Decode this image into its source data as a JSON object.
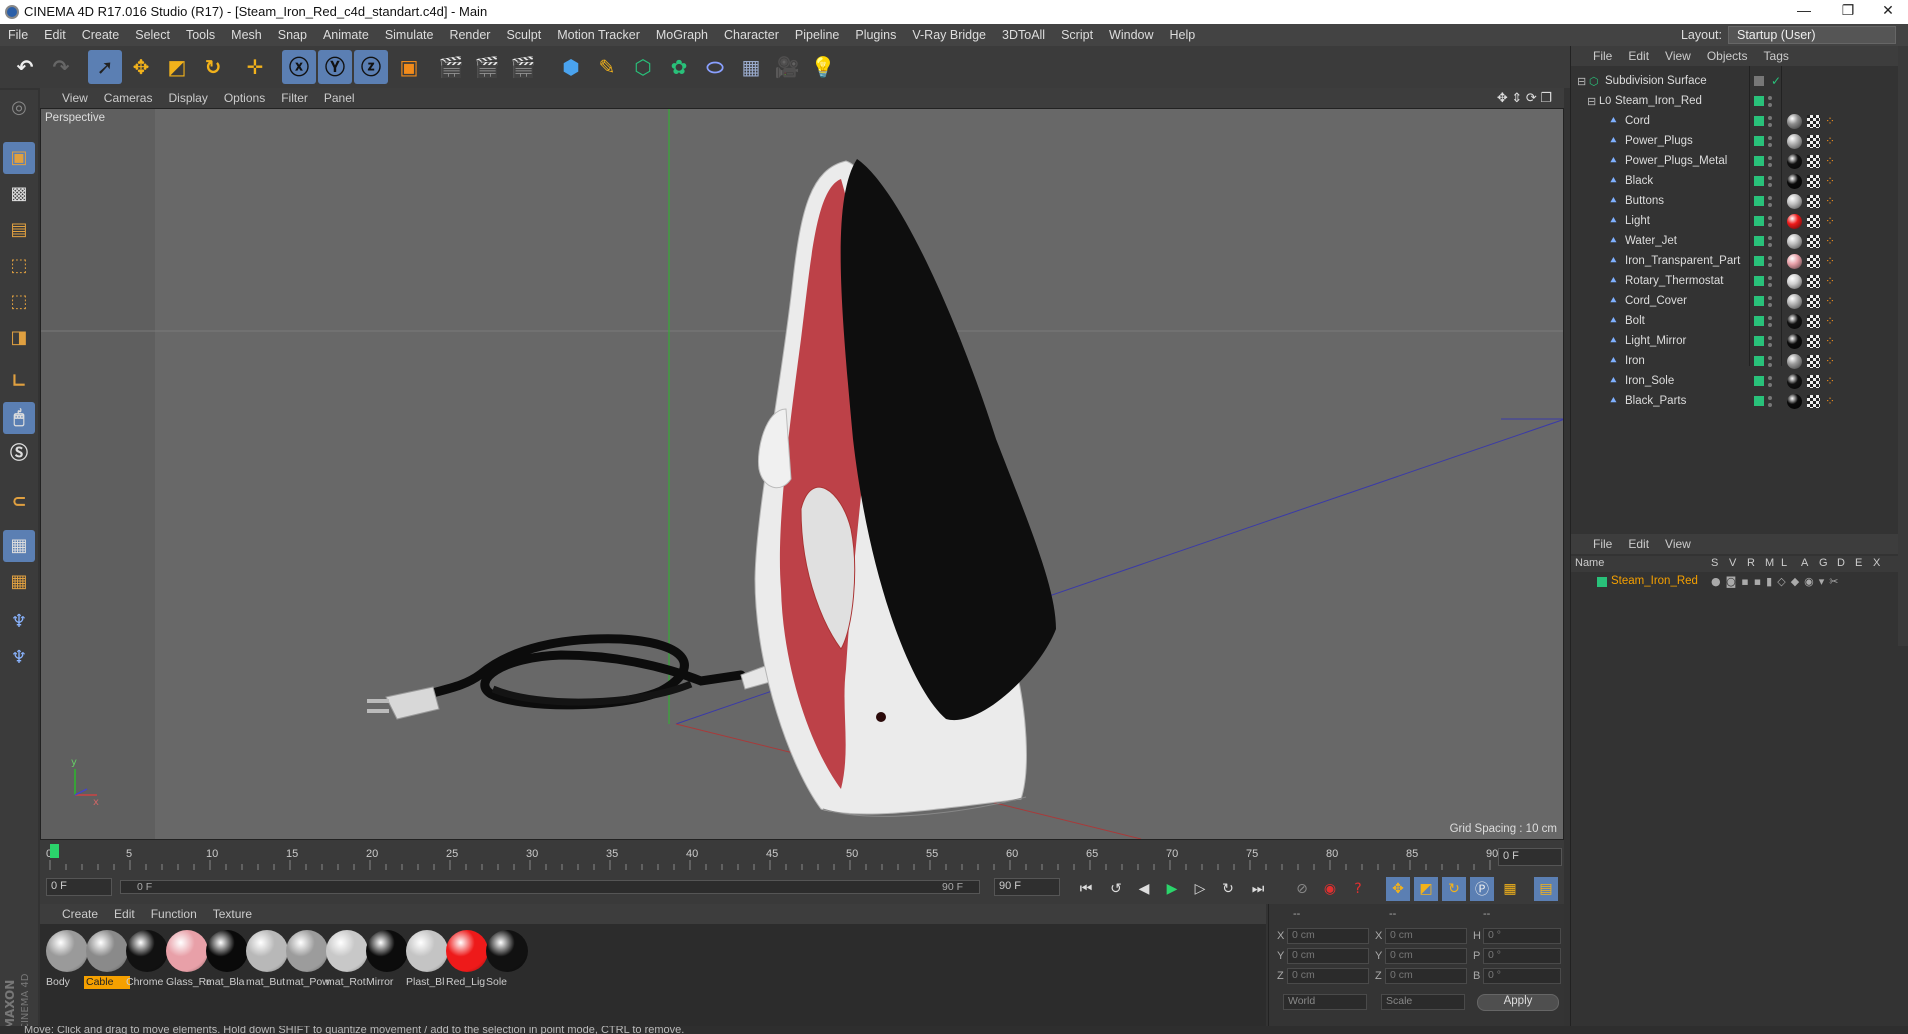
{
  "window": {
    "title": "CINEMA 4D R17.016 Studio (R17) - [Steam_Iron_Red_c4d_standart.c4d] - Main",
    "controls": [
      "—",
      "❐",
      "✕"
    ]
  },
  "menubar": [
    "File",
    "Edit",
    "Create",
    "Select",
    "Tools",
    "Mesh",
    "Snap",
    "Animate",
    "Simulate",
    "Render",
    "Sculpt",
    "Motion Tracker",
    "MoGraph",
    "Character",
    "Pipeline",
    "Plugins",
    "V-Ray Bridge",
    "3DToAll",
    "Script",
    "Window",
    "Help"
  ],
  "layout": {
    "label": "Layout:",
    "value": "Startup (User)"
  },
  "viewport": {
    "menu": [
      "View",
      "Cameras",
      "Display",
      "Options",
      "Filter",
      "Panel"
    ],
    "camera_label": "Perspective",
    "grid_spacing": "Grid Spacing : 10 cm",
    "axis_y": "y",
    "axis_x": "x"
  },
  "timeline": {
    "ticks": [
      "0",
      "5",
      "10",
      "15",
      "20",
      "25",
      "30",
      "35",
      "40",
      "45",
      "50",
      "55",
      "60",
      "65",
      "70",
      "75",
      "80",
      "85",
      "90"
    ],
    "current_frame_field": "0 F",
    "start_field": "0 F",
    "range_start": "0 F",
    "range_end": "90 F",
    "end_field": "90 F"
  },
  "materials": {
    "menu": [
      "Create",
      "Edit",
      "Function",
      "Texture"
    ],
    "items": [
      {
        "label": "Body",
        "color": "#9a9a9a"
      },
      {
        "label": "Cable",
        "color": "#8a8a8a",
        "selected": true
      },
      {
        "label": "Chrome",
        "color": "#111111"
      },
      {
        "label": "Glass_Re",
        "color": "#e8a0a8"
      },
      {
        "label": "mat_Bla",
        "color": "#0a0a0a"
      },
      {
        "label": "mat_But",
        "color": "#b8b8b8"
      },
      {
        "label": "mat_Pow",
        "color": "#9c9c9c"
      },
      {
        "label": "mat_Rot",
        "color": "#c8c8c8"
      },
      {
        "label": "Mirror",
        "color": "#0c0c0c"
      },
      {
        "label": "Plast_Bl",
        "color": "#c4c4c4"
      },
      {
        "label": "Red_Lig",
        "color": "#ee1a1a"
      },
      {
        "label": "Sole",
        "color": "#111111"
      }
    ]
  },
  "coords": {
    "headers": [
      "--",
      "--",
      "--"
    ],
    "rows": [
      {
        "a": "X",
        "av": "0 cm",
        "b": "X",
        "bv": "0 cm",
        "c": "H",
        "cv": "0 °"
      },
      {
        "a": "Y",
        "av": "0 cm",
        "b": "Y",
        "bv": "0 cm",
        "c": "P",
        "cv": "0 °"
      },
      {
        "a": "Z",
        "av": "0 cm",
        "b": "Z",
        "bv": "0 cm",
        "c": "B",
        "cv": "0 °"
      }
    ],
    "space": "World",
    "mode": "Scale",
    "apply": "Apply"
  },
  "object_manager": {
    "menu": [
      "File",
      "Edit",
      "View",
      "Objects",
      "Tags"
    ],
    "root": "Subdivision Surface",
    "group": "Steam_Iron_Red",
    "objects": [
      {
        "name": "Cord",
        "tag": "#8c8c8c"
      },
      {
        "name": "Power_Plugs",
        "tag": "#b0b0b0"
      },
      {
        "name": "Power_Plugs_Metal",
        "tag": "#111111"
      },
      {
        "name": "Black",
        "tag": "#0a0a0a"
      },
      {
        "name": "Buttons",
        "tag": "#c0c0c0"
      },
      {
        "name": "Light",
        "tag": "#ee1a1a"
      },
      {
        "name": "Water_Jet",
        "tag": "#bdbdbd"
      },
      {
        "name": "Iron_Transparent_Part",
        "tag": "#e8a0a8"
      },
      {
        "name": "Rotary_Thermostat",
        "tag": "#cfcfcf"
      },
      {
        "name": "Cord_Cover",
        "tag": "#b5b5b5"
      },
      {
        "name": "Bolt",
        "tag": "#111111"
      },
      {
        "name": "Light_Mirror",
        "tag": "#0c0c0c"
      },
      {
        "name": "Iron",
        "tag": "#9a9a9a"
      },
      {
        "name": "Iron_Sole",
        "tag": "#111111"
      },
      {
        "name": "Black_Parts",
        "tag": "#0a0a0a"
      }
    ]
  },
  "attribute_manager": {
    "menu": [
      "File",
      "Edit",
      "View"
    ],
    "columns": [
      "Name",
      "S",
      "V",
      "R",
      "M",
      "L",
      "A",
      "G",
      "D",
      "E",
      "X"
    ],
    "row_name": "Steam_Iron_Red"
  },
  "status": "Move: Click and drag to move elements. Hold down SHIFT to quantize movement / add to the selection in point mode, CTRL to remove."
}
